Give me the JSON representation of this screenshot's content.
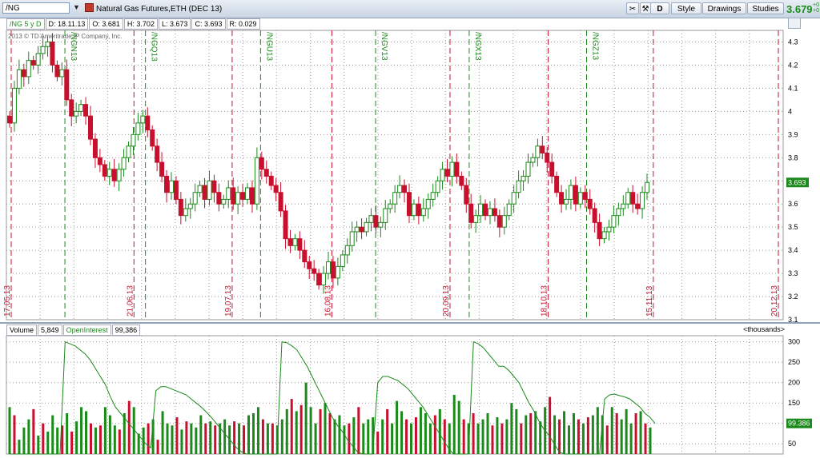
{
  "toolbar": {
    "symbol": "/NG",
    "instrument": "Natural Gas Futures,ETH (DEC 13)",
    "buttons": [
      "D",
      "Style",
      "Drawings",
      "Studies"
    ],
    "last_price": "3.679",
    "change_small": "+0",
    "change_small2": "+0"
  },
  "infobar": {
    "symbol_label": "/NG 5 y D",
    "date": "D: 18.11.13",
    "open": "O: 3.681",
    "high": "H: 3.702",
    "low": "L: 3.673",
    "close": "C: 3.693",
    "range": "R: 0.029"
  },
  "copyright": "2013 © TD Ameritrade IP Company, Inc.",
  "volume_bar": {
    "volume_label": "Volume",
    "volume_value": "5,849",
    "oi_label": "OpenInterest",
    "oi_value": "99,386",
    "units": "<thousands>"
  },
  "colors": {
    "up": "#1b8a1b",
    "down": "#c8102e",
    "grid": "#9a9a9a",
    "price_tag": "#1b8a1b"
  },
  "chart_data": [
    {
      "type": "candlestick",
      "ylim": [
        3.1,
        4.35
      ],
      "yticks": [
        3.1,
        3.2,
        3.3,
        3.4,
        3.5,
        3.6,
        3.7,
        3.8,
        3.9,
        4.0,
        4.1,
        4.2,
        4.3
      ],
      "ytick_labels": [
        "3.1",
        "3.2",
        "3.3",
        "3.4",
        "3.5",
        "3.6",
        "3.7",
        "3.8",
        "3.9",
        "4",
        "4.1",
        "4.2",
        "4.3"
      ],
      "last_price_label": "3.693",
      "closes": [
        3.95,
        4.1,
        4.18,
        4.15,
        4.22,
        4.2,
        4.25,
        4.28,
        4.3,
        4.2,
        4.15,
        4.18,
        4.05,
        3.98,
        4.0,
        4.03,
        3.98,
        3.88,
        3.8,
        3.77,
        3.72,
        3.75,
        3.7,
        3.75,
        3.8,
        3.85,
        3.9,
        3.95,
        3.98,
        3.92,
        3.85,
        3.78,
        3.72,
        3.65,
        3.7,
        3.62,
        3.55,
        3.58,
        3.6,
        3.65,
        3.68,
        3.62,
        3.7,
        3.65,
        3.6,
        3.62,
        3.67,
        3.6,
        3.65,
        3.62,
        3.67,
        3.6,
        3.8,
        3.75,
        3.72,
        3.68,
        3.65,
        3.57,
        3.45,
        3.42,
        3.45,
        3.4,
        3.35,
        3.32,
        3.3,
        3.25,
        3.3,
        3.35,
        3.28,
        3.33,
        3.38,
        3.42,
        3.48,
        3.5,
        3.48,
        3.52,
        3.55,
        3.5,
        3.52,
        3.58,
        3.6,
        3.65,
        3.68,
        3.65,
        3.55,
        3.6,
        3.55,
        3.58,
        3.62,
        3.65,
        3.7,
        3.75,
        3.72,
        3.78,
        3.72,
        3.68,
        3.6,
        3.52,
        3.55,
        3.6,
        3.55,
        3.58,
        3.55,
        3.5,
        3.55,
        3.6,
        3.65,
        3.7,
        3.72,
        3.78,
        3.8,
        3.85,
        3.82,
        3.78,
        3.72,
        3.65,
        3.6,
        3.62,
        3.68,
        3.6,
        3.65,
        3.62,
        3.58,
        3.52,
        3.45,
        3.48,
        3.5,
        3.55,
        3.58,
        3.6,
        3.65,
        3.6,
        3.58,
        3.65,
        3.693
      ],
      "date_markers": [
        {
          "label": "17.05.13",
          "frac": 0.0
        },
        {
          "label": "21.06.13",
          "frac": 0.16
        },
        {
          "label": "19.07.13",
          "frac": 0.288
        },
        {
          "label": "16.08.13",
          "frac": 0.418
        },
        {
          "label": "20.09.13",
          "frac": 0.572
        },
        {
          "label": "18.10.13",
          "frac": 0.7
        },
        {
          "label": "15.11.13",
          "frac": 0.837
        },
        {
          "label": "20.12.13",
          "frac": 1.0
        }
      ],
      "contract_markers": [
        {
          "label": "/NGN13",
          "frac": 0.07
        },
        {
          "label": "/NGQ13",
          "frac": 0.175
        },
        {
          "label": "/NGU13",
          "frac": 0.325
        },
        {
          "label": "/NGV13",
          "frac": 0.475
        },
        {
          "label": "/NGX13",
          "frac": 0.597
        },
        {
          "label": "/NGZ13",
          "frac": 0.75
        }
      ]
    },
    {
      "type": "bar",
      "series": [
        {
          "name": "Volume",
          "values": [
            140,
            120,
            60,
            90,
            110,
            135,
            70,
            100,
            80,
            120,
            90,
            95,
            125,
            80,
            105,
            140,
            130,
            100,
            90,
            95,
            140,
            120,
            95,
            85,
            125,
            155,
            140,
            75,
            90,
            100,
            110,
            60,
            130,
            100,
            95,
            115,
            85,
            105,
            100,
            90,
            120,
            100,
            105,
            95,
            100,
            110,
            95,
            105,
            100,
            95,
            120,
            125,
            140,
            110,
            100,
            100,
            95,
            110,
            135,
            160,
            130,
            145,
            200,
            140,
            100,
            135,
            150,
            125,
            110,
            120,
            95,
            100,
            115,
            140,
            100,
            110,
            115,
            80,
            110,
            135,
            100,
            155,
            130,
            110,
            100,
            115,
            140,
            125,
            100,
            120,
            135,
            110,
            100,
            170,
            155,
            110,
            100,
            125,
            100,
            110,
            125,
            95,
            115,
            100,
            110,
            150,
            135,
            100,
            120,
            125,
            130,
            105,
            140,
            165,
            120,
            110,
            130,
            95,
            125,
            110,
            100,
            115,
            120,
            140,
            120,
            95,
            140,
            125,
            110,
            135,
            100,
            125,
            130,
            100,
            90
          ]
        },
        {
          "name": "OpenInterest",
          "values": [
            0,
            0,
            0,
            0,
            0,
            0,
            0,
            0,
            0,
            0,
            0,
            300,
            295,
            290,
            280,
            270,
            255,
            235,
            215,
            195,
            165,
            140,
            125,
            110,
            95,
            80,
            65,
            50,
            40,
            180,
            190,
            190,
            185,
            180,
            175,
            170,
            160,
            150,
            140,
            128,
            115,
            100,
            85,
            70,
            55,
            40,
            30,
            20,
            10,
            0,
            0,
            0,
            0,
            0,
            300,
            298,
            290,
            280,
            260,
            240,
            215,
            190,
            165,
            140,
            115,
            95,
            80,
            60,
            45,
            30,
            20,
            10,
            0,
            200,
            215,
            215,
            210,
            205,
            195,
            185,
            170,
            155,
            140,
            120,
            100,
            80,
            60,
            40,
            25,
            10,
            0,
            0,
            300,
            295,
            285,
            270,
            255,
            240,
            240,
            230,
            215,
            200,
            175,
            150,
            130,
            105,
            85,
            70,
            50,
            30,
            20,
            10,
            0,
            0,
            0,
            0,
            0,
            0,
            160,
            170,
            172,
            168,
            165,
            160,
            150,
            140,
            125,
            115,
            100
          ]
        }
      ],
      "ylim": [
        25,
        315
      ],
      "yticks": [
        50,
        100,
        150,
        200,
        250,
        300
      ],
      "last_oi_label": "99.386"
    }
  ]
}
